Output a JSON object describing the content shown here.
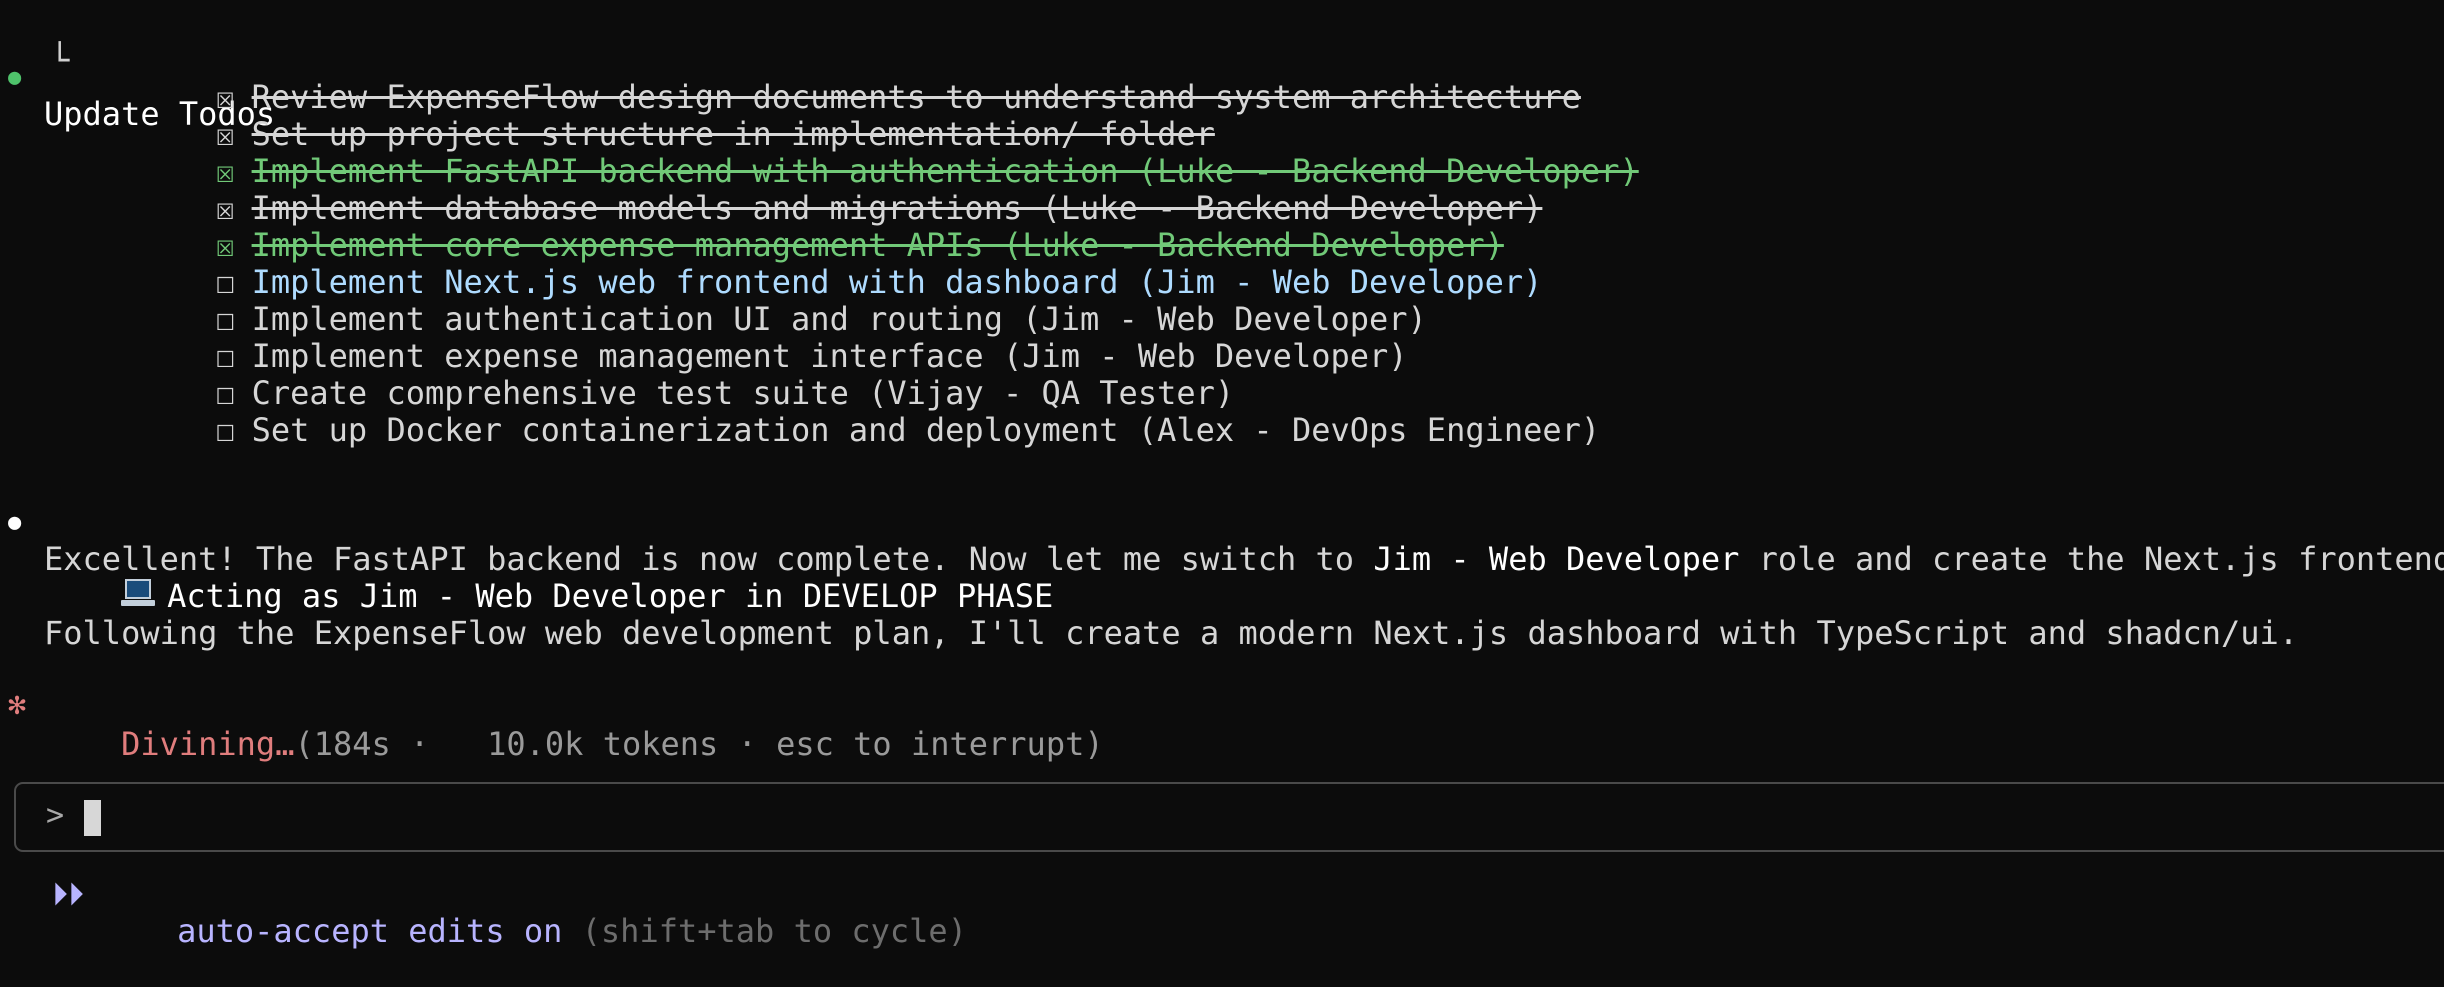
{
  "todos_title": "Update Todos",
  "tree_glyph": "└",
  "checkbox": {
    "checked": "☒",
    "unchecked": "☐"
  },
  "todos": [
    {
      "text": "Review ExpenseFlow design documents to understand system architecture",
      "done": true,
      "color": "#d6d6d6"
    },
    {
      "text": "Set up project structure in implementation/ folder",
      "done": true,
      "color": "#d6d6d6"
    },
    {
      "text": "Implement FastAPI backend with authentication (Luke - Backend Developer)",
      "done": true,
      "color": "#71c978"
    },
    {
      "text": "Implement database models and migrations (Luke - Backend Developer)",
      "done": true,
      "color": "#d6d6d6"
    },
    {
      "text": "Implement core expense management APIs (Luke - Backend Developer)",
      "done": true,
      "color": "#71c978"
    },
    {
      "text": "Implement Next.js web frontend with dashboard (Jim - Web Developer)",
      "done": false,
      "color": "#aedbff"
    },
    {
      "text": "Implement authentication UI and routing (Jim - Web Developer)",
      "done": false,
      "color": "#d6d6d6"
    },
    {
      "text": "Implement expense management interface (Jim - Web Developer)",
      "done": false,
      "color": "#d6d6d6"
    },
    {
      "text": "Create comprehensive test suite (Vijay - QA Tester)",
      "done": false,
      "color": "#d6d6d6"
    },
    {
      "text": "Set up Docker containerization and deployment (Alex - DevOps Engineer)",
      "done": false,
      "color": "#d6d6d6"
    }
  ],
  "message": {
    "part1": "Excellent! The FastAPI backend is now complete. Now let me switch to ",
    "bold": "Jim - Web Developer",
    "part2": " role and create the Next.js frontend."
  },
  "acting_line": "Acting as Jim - Web Developer in DEVELOP PHASE",
  "following_line": "Following the ExpenseFlow web development plan, I'll create a modern Next.js dashboard with TypeScript and shadcn/ui.",
  "status": {
    "spinner_glyph": "✻",
    "verb": "Divining…",
    "detail": "(184s ·   10.0k tokens · esc to interrupt)"
  },
  "prompt": {
    "symbol": ">",
    "value": ""
  },
  "mode": {
    "arrow_glyph": "⏵⏵",
    "label": "auto-accept edits on",
    "hint": "(shift+tab to cycle)"
  },
  "colors": {
    "background": "#0c0c0c",
    "done_green": "#71c978",
    "active_blue": "#aedbff",
    "spinner_red": "#e07d7d",
    "mode_violet": "#b8b4ff"
  }
}
